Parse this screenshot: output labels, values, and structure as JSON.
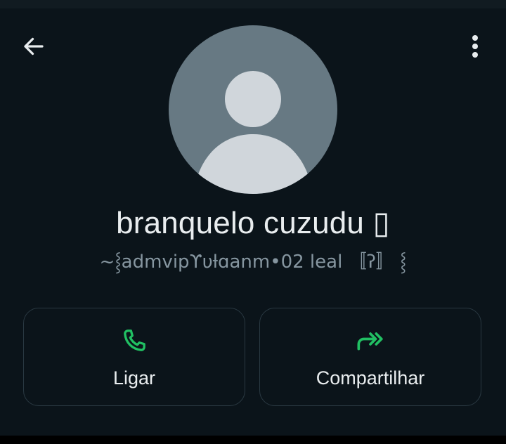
{
  "header": {
    "back_icon": "arrow-left-icon",
    "more_icon": "more-vertical-icon"
  },
  "profile": {
    "avatar_icon": "default-person-avatar",
    "name": "branquelo cuzudu ▯",
    "subtitle": "~⸾admvipϒυƚɑanm•02 leal  〚ʔ〛 ⸾"
  },
  "actions": [
    {
      "label": "Ligar",
      "icon": "phone-icon"
    },
    {
      "label": "Compartilhar",
      "icon": "share-forward-icon"
    }
  ],
  "colors": {
    "background": "#0b141a",
    "accent_green": "#21c063",
    "avatar_bg": "#677983",
    "avatar_fg": "#cfd8dc",
    "muted_text": "#8696a0"
  }
}
